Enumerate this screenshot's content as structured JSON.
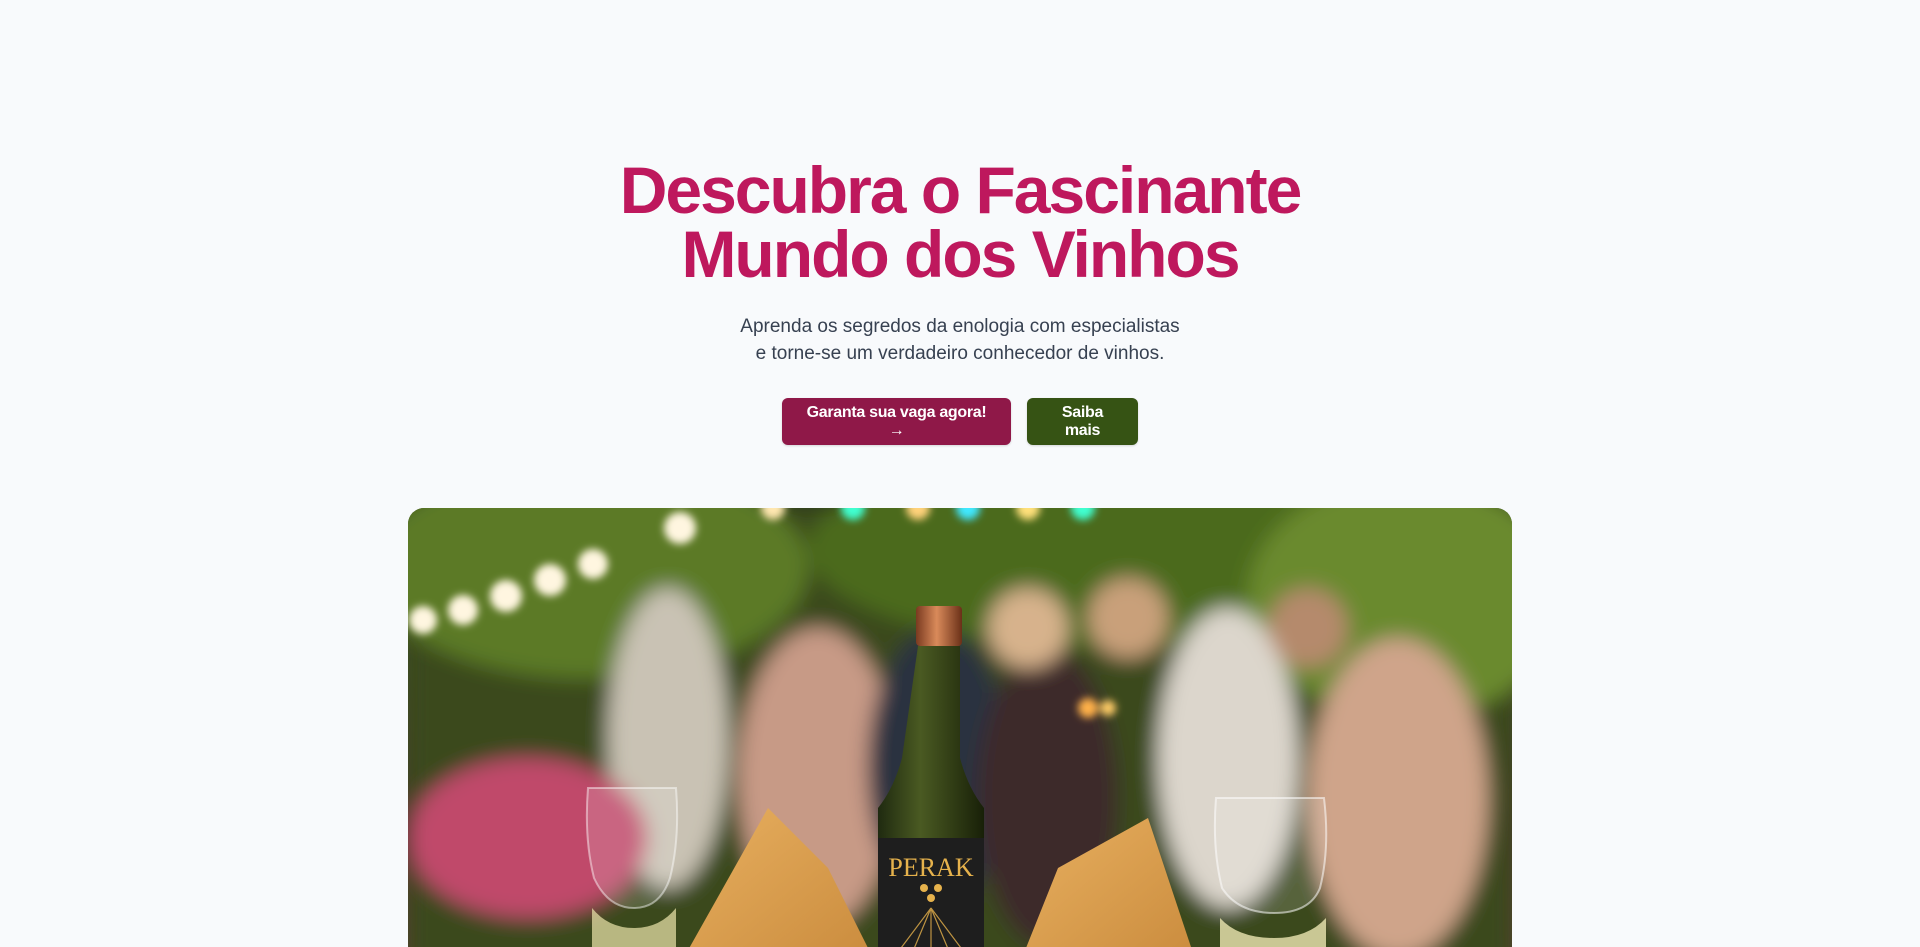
{
  "hero": {
    "title_line1": "Descubra o Fascinante",
    "title_line2": "Mundo dos Vinhos",
    "subtitle_line1": "Aprenda os segredos da enologia com especialistas",
    "subtitle_line2": "e torne-se um verdadeiro conhecedor de vinhos.",
    "primary_button": "Garanta sua vaga agora! →",
    "secondary_button": "Saiba mais",
    "image_label": "PERAK"
  },
  "colors": {
    "background": "#f8fafc",
    "title": "#be185d",
    "primary_button": "#8f1848",
    "secondary_button": "#365314"
  }
}
